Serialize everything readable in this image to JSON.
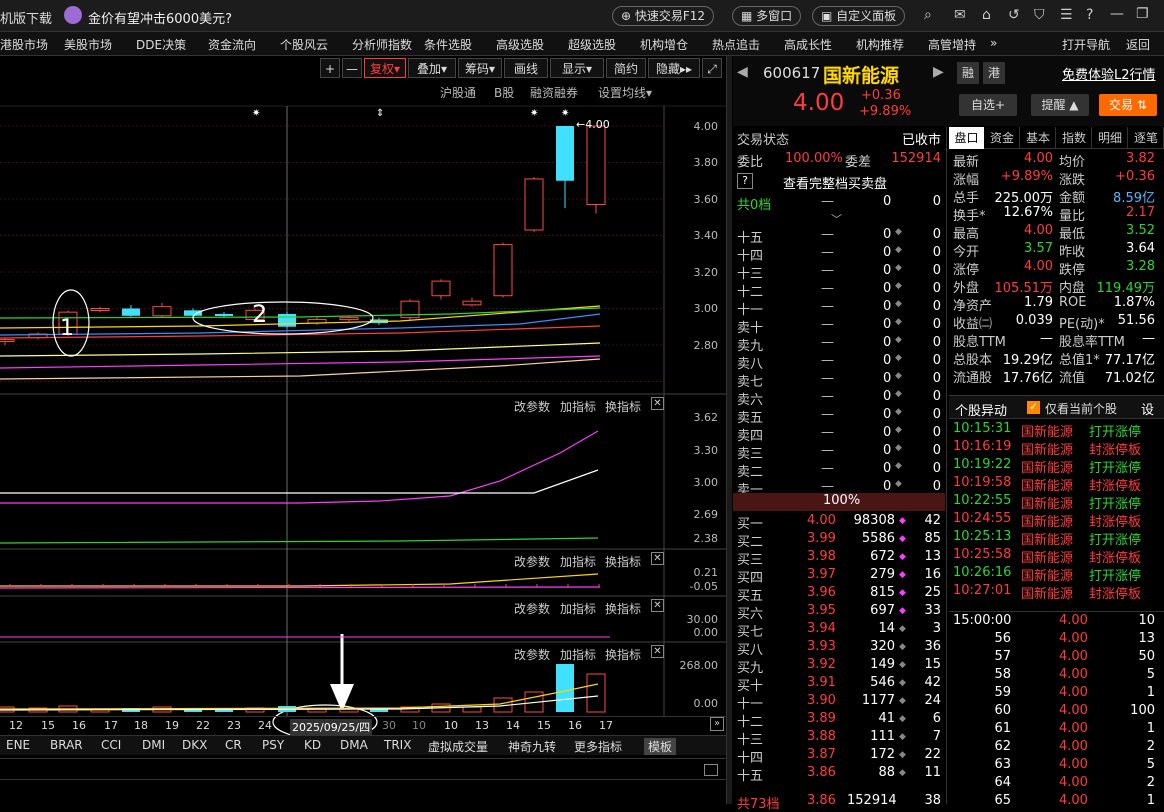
{
  "top": {
    "left_label": "机版下载",
    "headline": "金价有望冲击6000美元?",
    "fast_trade": "快速交易F12",
    "multi_window": "多窗口",
    "custom_panel": "自定义面板"
  },
  "nav": [
    "港股市场",
    "美股市场",
    "DDE决策",
    "资金流向",
    "个股风云",
    "分析师指数",
    "条件选股",
    "高级选股",
    "超级选股",
    "机构增仓",
    "热点追击",
    "高成长性",
    "机构推荐",
    "高管增持",
    "»",
    "打开导航",
    "返回"
  ],
  "toolbar": {
    "plus": "+",
    "minus": "—",
    "adjust": "复权",
    "overlay": "叠加",
    "chips": "筹码",
    "draw": "画线",
    "display": "显示",
    "simple": "简约",
    "hide": "隐藏"
  },
  "chart_tabs": {
    "hgt": "沪股通",
    "b": "B股",
    "margin": "融资融券",
    "ma": "设置均线"
  },
  "price_axis": [
    "4.00",
    "3.80",
    "3.60",
    "3.40",
    "3.20",
    "3.00",
    "2.80"
  ],
  "ind_labels": {
    "change_param": "改参数",
    "add_ind": "加指标",
    "switch_ind": "换指标"
  },
  "ind1_axis": [
    "3.62",
    "3.30",
    "3.00",
    "2.69",
    "2.38"
  ],
  "ind2_axis": [
    "0.21",
    "-0.05"
  ],
  "ind3_axis": [
    "30.00",
    "0.00"
  ],
  "ind4_axis": [
    "268.00",
    "0.00"
  ],
  "annotations": {
    "mark1": "1",
    "mark2": "2",
    "high_label": "4.00"
  },
  "dates": [
    "12",
    "15",
    "16",
    "17",
    "18",
    "19",
    "22",
    "23",
    "24",
    "2025/09/25/四",
    "30",
    "10",
    "10",
    "13",
    "14",
    "15",
    "16",
    "17"
  ],
  "bottom_tabs": [
    "ENE",
    "BRAR",
    "CCI",
    "DMI",
    "DKX",
    "CR",
    "PSY",
    "KD",
    "DMA",
    "TRIX",
    "虚拟成交量",
    "神奇九转",
    "更多指标",
    "模板"
  ],
  "stock": {
    "code": "600617",
    "name": "国新能源",
    "price": "4.00",
    "change": "+0.36",
    "pct": "+9.89%",
    "tag1": "融",
    "tag2": "港",
    "l2": "免费体验L2行情",
    "watch": "自选+",
    "remind": "提醒",
    "trade": "交易"
  },
  "order": {
    "status_label": "交易状态",
    "status": "已收市",
    "ratio_label": "委比",
    "ratio": "100.00%",
    "diff_label": "委差",
    "diff": "152914",
    "full_book": "查看完整档买卖盘",
    "total_label": "共0档",
    "total_a": "0",
    "total_b": "0",
    "pct_bar": "100%",
    "bottom_label": "共73档",
    "bottom_price": "3.86",
    "bottom_vol": "152914",
    "bottom_cnt": "38"
  },
  "asks": [
    [
      "十五",
      "—",
      "0",
      "0"
    ],
    [
      "十四",
      "—",
      "0",
      "0"
    ],
    [
      "十三",
      "—",
      "0",
      "0"
    ],
    [
      "十二",
      "—",
      "0",
      "0"
    ],
    [
      "十一",
      "—",
      "0",
      "0"
    ],
    [
      "卖十",
      "—",
      "0",
      "0"
    ],
    [
      "卖九",
      "—",
      "0",
      "0"
    ],
    [
      "卖八",
      "—",
      "0",
      "0"
    ],
    [
      "卖七",
      "—",
      "0",
      "0"
    ],
    [
      "卖六",
      "—",
      "0",
      "0"
    ],
    [
      "卖五",
      "—",
      "0",
      "0"
    ],
    [
      "卖四",
      "—",
      "0",
      "0"
    ],
    [
      "卖三",
      "—",
      "0",
      "0"
    ],
    [
      "卖二",
      "—",
      "0",
      "0"
    ],
    [
      "卖一",
      "—",
      "0",
      "0"
    ]
  ],
  "bids": [
    [
      "买一",
      "4.00",
      "98308",
      "42"
    ],
    [
      "买二",
      "3.99",
      "5586",
      "85"
    ],
    [
      "买三",
      "3.98",
      "672",
      "13"
    ],
    [
      "买四",
      "3.97",
      "279",
      "16"
    ],
    [
      "买五",
      "3.96",
      "815",
      "25"
    ],
    [
      "买六",
      "3.95",
      "697",
      "33"
    ],
    [
      "买七",
      "3.94",
      "14",
      "3"
    ],
    [
      "买八",
      "3.93",
      "320",
      "36"
    ],
    [
      "买九",
      "3.92",
      "149",
      "15"
    ],
    [
      "买十",
      "3.91",
      "546",
      "42"
    ],
    [
      "十一",
      "3.90",
      "1177",
      "24"
    ],
    [
      "十二",
      "3.89",
      "41",
      "6"
    ],
    [
      "十三",
      "3.88",
      "111",
      "7"
    ],
    [
      "十四",
      "3.87",
      "172",
      "22"
    ],
    [
      "十五",
      "3.86",
      "88",
      "11"
    ]
  ],
  "quote_tabs": [
    "盘口",
    "资金",
    "基本",
    "指数",
    "明细",
    "逐笔"
  ],
  "quote": [
    [
      "最新",
      "4.00",
      "均价",
      "3.82"
    ],
    [
      "涨幅",
      "+9.89%",
      "涨跌",
      "+0.36"
    ],
    [
      "总手",
      "225.00万",
      "金额",
      "8.59亿"
    ],
    [
      "换手*",
      "12.67%",
      "量比",
      "2.17"
    ],
    [
      "最高",
      "4.00",
      "最低",
      "3.52"
    ],
    [
      "今开",
      "3.57",
      "昨收",
      "3.64"
    ],
    [
      "涨停",
      "4.00",
      "跌停",
      "3.28"
    ],
    [
      "外盘",
      "105.51万",
      "内盘",
      "119.49万"
    ],
    [
      "净资产",
      "1.79",
      "ROE",
      "1.87%"
    ],
    [
      "收益㈡",
      "0.039",
      "PE(动)*",
      "51.56"
    ],
    [
      "股息TTM",
      "—",
      "股息率TTM",
      "—"
    ],
    [
      "总股本",
      "19.29亿",
      "总值1*",
      "77.17亿"
    ],
    [
      "流通股",
      "17.76亿",
      "流值",
      "71.02亿"
    ]
  ],
  "alerts_header": {
    "title": "个股异动",
    "only": "仅看当前个股",
    "settings": "设"
  },
  "alerts": [
    [
      "10:15:31",
      "国新能源",
      "打开涨停"
    ],
    [
      "10:16:19",
      "国新能源",
      "封涨停板"
    ],
    [
      "10:19:22",
      "国新能源",
      "打开涨停"
    ],
    [
      "10:19:58",
      "国新能源",
      "封涨停板"
    ],
    [
      "10:22:55",
      "国新能源",
      "打开涨停"
    ],
    [
      "10:24:55",
      "国新能源",
      "封涨停板"
    ],
    [
      "10:25:13",
      "国新能源",
      "打开涨停"
    ],
    [
      "10:25:58",
      "国新能源",
      "封涨停板"
    ],
    [
      "10:26:16",
      "国新能源",
      "打开涨停"
    ],
    [
      "10:27:01",
      "国新能源",
      "封涨停板"
    ]
  ],
  "ticks": [
    [
      "15:00:00",
      "4.00",
      "10"
    ],
    [
      "56",
      "4.00",
      "13"
    ],
    [
      "57",
      "4.00",
      "50"
    ],
    [
      "58",
      "4.00",
      "5"
    ],
    [
      "59",
      "4.00",
      "1"
    ],
    [
      "60",
      "4.00",
      "100"
    ],
    [
      "61",
      "4.00",
      "1"
    ],
    [
      "62",
      "4.00",
      "2"
    ],
    [
      "63",
      "4.00",
      "5"
    ],
    [
      "64",
      "4.00",
      "2"
    ],
    [
      "65",
      "4.00",
      "1"
    ]
  ]
}
